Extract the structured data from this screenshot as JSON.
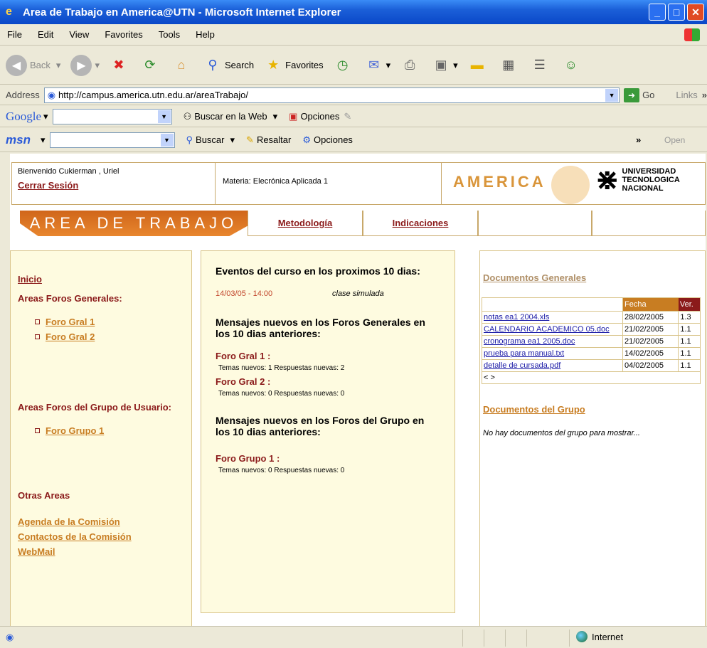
{
  "window": {
    "title": "Area de Trabajo en America@UTN - Microsoft Internet Explorer",
    "minimize": "_",
    "maximize": "□",
    "close": "✕"
  },
  "menu": [
    "File",
    "Edit",
    "View",
    "Favorites",
    "Tools",
    "Help"
  ],
  "toolbar": {
    "back": "Back",
    "search": "Search",
    "favorites": "Favorites"
  },
  "address": {
    "label": "Address",
    "url": "http://campus.america.utn.edu.ar/areaTrabajo/",
    "go": "Go",
    "links": "Links"
  },
  "google_bar": {
    "brand": "Google",
    "search_web": "Buscar en la Web",
    "options": "Opciones"
  },
  "msn_bar": {
    "brand": "msn",
    "search": "Buscar",
    "highlight": "Resaltar",
    "options": "Opciones",
    "open": "Open"
  },
  "header": {
    "welcome": "Bienvenido Cukierman , Uriel",
    "logout": "Cerrar Sesión",
    "subject": "Materia: Elecrónica Aplicada 1",
    "america_logo": "AMERICA",
    "utn_line1": "UNIVERSIDAD",
    "utn_line2": "TECNOLOGICA",
    "utn_line3": "NACIONAL"
  },
  "tabs": {
    "main": "AREA DE TRABAJO",
    "methodology": "Metodología",
    "instructions": "Indicaciones"
  },
  "left": {
    "home": "Inicio",
    "general_forums": "Areas Foros Generales:",
    "general_items": [
      "Foro Gral 1",
      "Foro Gral 2"
    ],
    "group_forums": "Areas Foros del Grupo de Usuario:",
    "group_items": [
      "Foro Grupo 1"
    ],
    "other_areas": "Otras Areas",
    "other_links": [
      "Agenda de la Comisión",
      "Contactos de la Comisión",
      "WebMail"
    ]
  },
  "middle": {
    "events_title": "Eventos del curso en los proximos 10 dias:",
    "event_date": "14/03/05 - 14:00",
    "event_desc": "clase simulada",
    "general_msgs_title": "Mensajes nuevos en los Foros Generales en los 10 dias anteriores:",
    "forum1_name": "Foro Gral 1 :",
    "forum1_stats": "Temas nuevos: 1 Respuestas nuevas: 2",
    "forum2_name": "Foro Gral 2 :",
    "forum2_stats": "Temas nuevos: 0 Respuestas nuevas: 0",
    "group_msgs_title": "Mensajes nuevos en los Foros del Grupo en los 10 dias anteriores:",
    "group1_name": "Foro Grupo 1 :",
    "group1_stats": "Temas nuevos: 0 Respuestas nuevas: 0"
  },
  "right": {
    "general_docs": "Documentos Generales",
    "col_date": "Fecha",
    "col_ver": "Ver.",
    "docs": [
      {
        "name": "notas ea1 2004.xls",
        "date": "28/02/2005",
        "ver": "1.3"
      },
      {
        "name": "CALENDARIO ACADEMICO 05.doc",
        "date": "21/02/2005",
        "ver": "1.1"
      },
      {
        "name": "cronograma ea1 2005.doc",
        "date": "21/02/2005",
        "ver": "1.1"
      },
      {
        "name": "prueba para manual.txt",
        "date": "14/02/2005",
        "ver": "1.1"
      },
      {
        "name": "detalle de cursada.pdf",
        "date": "04/02/2005",
        "ver": "1.1"
      }
    ],
    "pager": "< >",
    "group_docs": "Documentos del Grupo",
    "no_group_docs": "No hay documentos del grupo para mostrar..."
  },
  "status": {
    "zone": "Internet"
  }
}
